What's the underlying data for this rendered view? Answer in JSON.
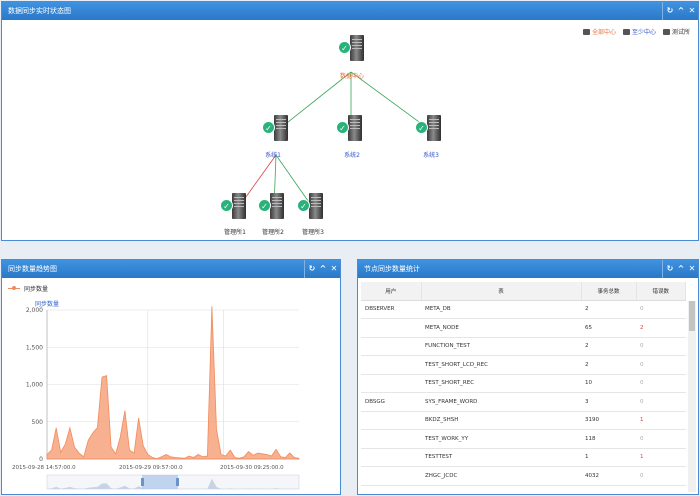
{
  "panel1": {
    "title": "数据同步实时状态图",
    "legend": [
      {
        "label": "全部中心",
        "color": "#e8703a"
      },
      {
        "label": "至少中心",
        "color": "#3355cc"
      },
      {
        "label": "测试所",
        "color": "#333333"
      }
    ],
    "nodes": {
      "center": "数据中心",
      "sys1": "系统1",
      "sys2": "系统2",
      "sys3": "系统3",
      "dept1": "管理所1",
      "dept2": "管理所2",
      "dept3": "管理所3"
    }
  },
  "panel2": {
    "title": "同步数量趋势图",
    "legend": "同步数量",
    "axis_title": "同步数量"
  },
  "panel3": {
    "title": "节点同步数量统计",
    "columns": [
      "用户",
      "表",
      "事务总数",
      "错误数"
    ],
    "rows": [
      {
        "user": "DBSERVER",
        "table": "META_DB",
        "total": "2",
        "errors": "0"
      },
      {
        "user": "",
        "table": "META_NODE",
        "total": "65",
        "errors": "2"
      },
      {
        "user": "",
        "table": "FUNCTION_TEST",
        "total": "2",
        "errors": "0"
      },
      {
        "user": "",
        "table": "TEST_SHORT_LCD_REC",
        "total": "2",
        "errors": "0"
      },
      {
        "user": "",
        "table": "TEST_SHORT_REC",
        "total": "10",
        "errors": "0"
      },
      {
        "user": "DBSGG",
        "table": "SYS_FRAME_WORD",
        "total": "3",
        "errors": "0"
      },
      {
        "user": "",
        "table": "BKDZ_SHSH",
        "total": "3190",
        "errors": "1"
      },
      {
        "user": "",
        "table": "TEST_WORK_YY",
        "total": "118",
        "errors": "0"
      },
      {
        "user": "",
        "table": "TESTTEST",
        "total": "1",
        "errors": "1"
      },
      {
        "user": "",
        "table": "ZHGC_JCDC",
        "total": "4032",
        "errors": "0"
      }
    ]
  },
  "chart_data": {
    "type": "area",
    "title": "",
    "legend": [
      "同步数量"
    ],
    "xlabel": "",
    "ylabel": "同步数量",
    "ylim": [
      0,
      2000
    ],
    "yticks": [
      "0",
      "500",
      "1,000",
      "1,500",
      "2,000"
    ],
    "xticks": [
      "2015-09-28 14:57:00.0",
      "2015-09-29 09:57:00.0",
      "2015-09-30 09:25:00.0"
    ],
    "values": [
      60,
      120,
      420,
      90,
      200,
      420,
      160,
      80,
      30,
      250,
      350,
      420,
      1100,
      1120,
      160,
      70,
      300,
      650,
      120,
      80,
      550,
      180,
      60,
      20,
      5,
      30,
      60,
      30,
      20,
      15,
      10,
      40,
      20,
      60,
      30,
      40,
      2050,
      400,
      60,
      40,
      120,
      20,
      10,
      30,
      100,
      50,
      80,
      70,
      60,
      40,
      130,
      30,
      20,
      80,
      20,
      10
    ],
    "series_color": "#f08b5b"
  }
}
